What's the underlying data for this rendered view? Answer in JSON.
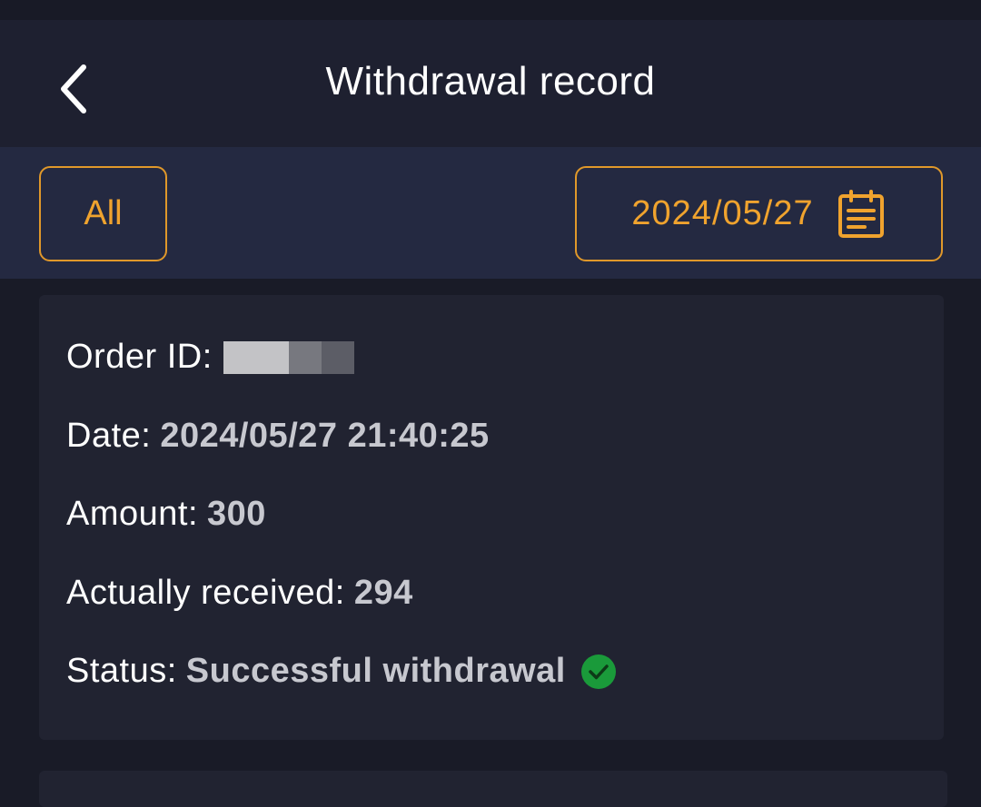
{
  "header": {
    "title": "Withdrawal record",
    "back_icon": "chevron-left-icon"
  },
  "filters": {
    "status_label": "All",
    "date_label": "2024/05/27",
    "date_icon": "calendar-icon",
    "accent_color": "#f0a32e"
  },
  "records": [
    {
      "order_id_label": "Order ID:",
      "order_id_value": "",
      "date_label": "Date:",
      "date_value": "2024/05/27 21:40:25",
      "amount_label": "Amount:",
      "amount_value": "300",
      "received_label": "Actually received:",
      "received_value": "294",
      "status_label": "Status:",
      "status_value": "Successful withdrawal",
      "status_icon": "check-circle-icon",
      "status_color": "#1a9a3a"
    }
  ]
}
